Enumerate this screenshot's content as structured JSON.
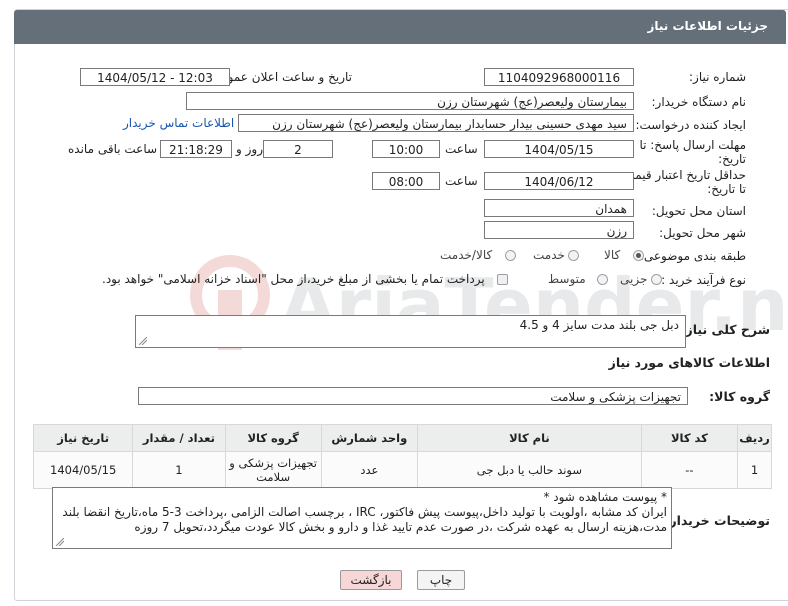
{
  "header": {
    "title": "جزئیات اطلاعات نیاز"
  },
  "fields": {
    "need_number_label": "شماره نیاز:",
    "need_number": "1104092968000116",
    "announce_label": "تاریخ و ساعت اعلان عمومی:",
    "announce_value": "1404/05/12 - 12:03",
    "buyer_org_label": "نام دستگاه خریدار:",
    "buyer_org": "بیمارستان ولیعصر(عج) شهرستان رزن",
    "requester_label": "ایجاد کننده درخواست:",
    "requester": "سید مهدی حسینی بیدار حسابدار بیمارستان ولیعصر(عج) شهرستان رزن",
    "contact_link": "اطلاعات تماس خریدار",
    "deadline_label_1": "مهلت ارسال پاسخ: تا",
    "deadline_label_2": "تاریخ:",
    "deadline_date": "1404/05/15",
    "time_label": "ساعت",
    "deadline_time": "10:00",
    "days_value": "2",
    "days_label": "روز و",
    "remaining_time": "21:18:29",
    "remaining_label": "ساعت باقی مانده",
    "validity_label_1": "حداقل تاریخ اعتبار قیمت:",
    "validity_label_2": "تا تاریخ:",
    "validity_date": "1404/06/12",
    "validity_time": "08:00",
    "province_label": "استان محل تحویل:",
    "province": "همدان",
    "city_label": "شهر محل تحویل:",
    "city": "رزن",
    "category_label": "طبقه بندی موضوعی:",
    "category_options": [
      "کالا",
      "خدمت",
      "کالا/خدمت"
    ],
    "process_label": "نوع فرآیند خرید :",
    "process_options": [
      "جزیی",
      "متوسط"
    ],
    "payment_note": "پرداخت تمام یا بخشی از مبلغ خرید،از محل \"اسناد خزانه اسلامی\" خواهد بود."
  },
  "description": {
    "label": "شرح کلی نیاز:",
    "value": "دبل جی بلند مدت سایز 4 و 4.5"
  },
  "goods": {
    "section_title": "اطلاعات کالاهای مورد نیاز",
    "group_label": "گروه کالا:",
    "group_value": "تجهیزات پزشکی و سلامت",
    "columns": [
      "ردیف",
      "کد کالا",
      "نام کالا",
      "واحد شمارش",
      "گروه کالا",
      "تعداد / مقدار",
      "تاریخ نیاز"
    ],
    "rows": [
      {
        "row": "1",
        "code": "--",
        "name": "سوند حالب یا دبل جی",
        "unit": "عدد",
        "group": "تجهیزات پزشکی و سلامت",
        "qty": "1",
        "date": "1404/05/15"
      }
    ]
  },
  "buyer_notes": {
    "label": "توضیحات خریدار:",
    "line1": "* پیوست مشاهده شود *",
    "line2": "ایران کد مشابه ،اولویت با تولید داخل،پیوست پیش فاکتور، IRC ، برچسب اصالت الزامی ،پرداخت 3-5 ماه،تاریخ انقضا بلند",
    "line3": "مدت،هزینه ارسال به عهده شرکت ،در صورت عدم تایید غذا و دارو و بخش کالا عودت میگردد،تحویل 7 روزه"
  },
  "buttons": {
    "print": "چاپ",
    "back": "بازگشت"
  },
  "watermark": {
    "text": "AriaTender.neT"
  },
  "colors": {
    "header": "#646f7a",
    "link": "#1a56b0",
    "back_button": "#f6d6d6"
  }
}
